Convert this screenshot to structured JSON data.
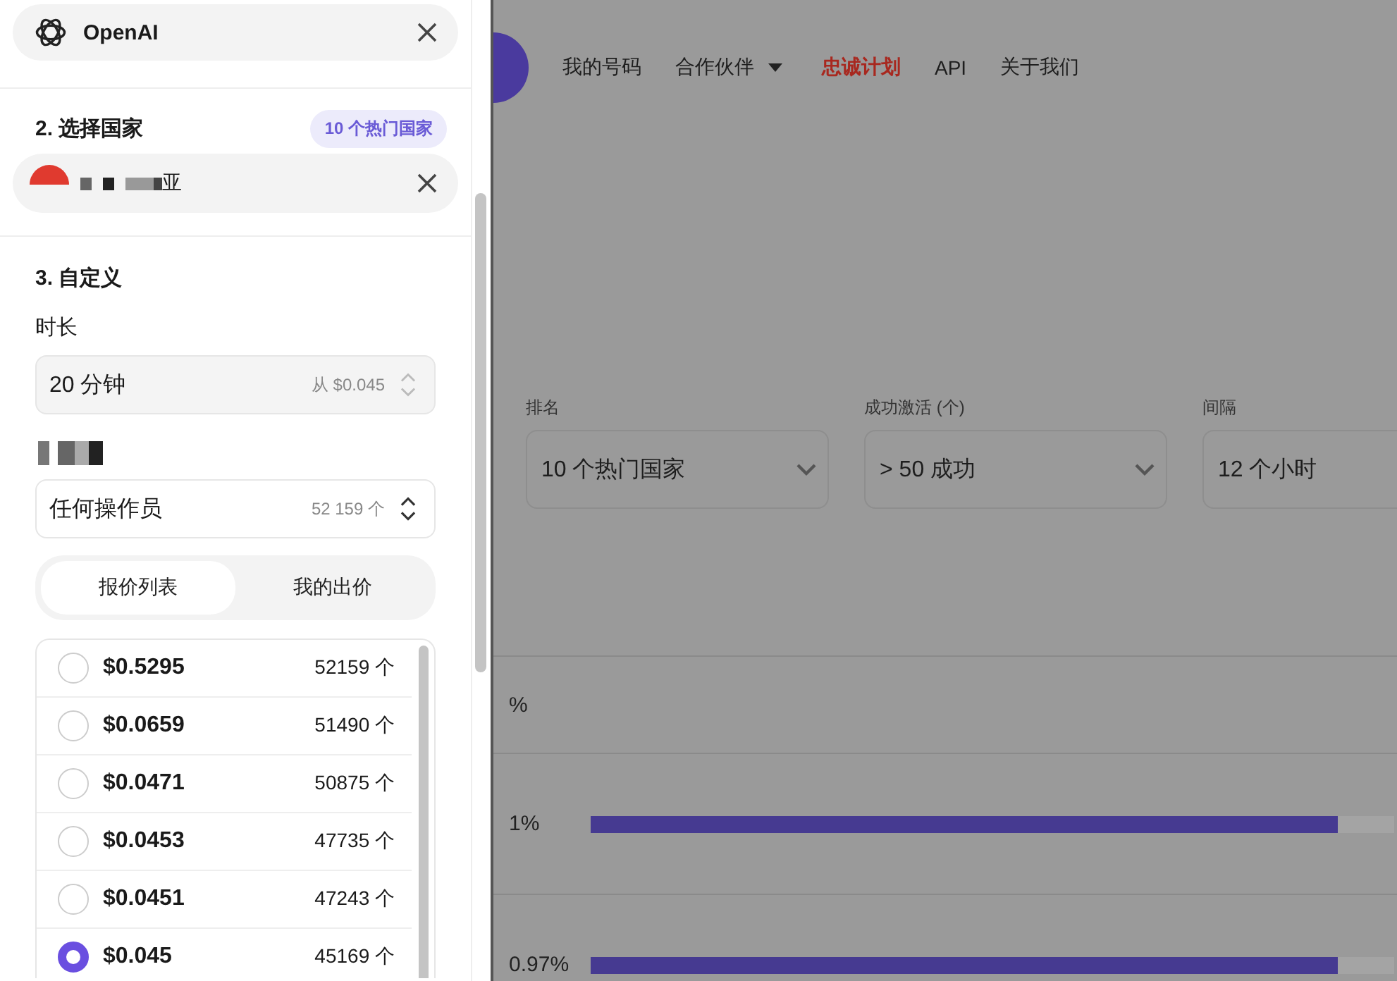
{
  "drawer": {
    "service": {
      "name": "OpenAI"
    },
    "country_section": {
      "title": "2. 选择国家",
      "badge": "10 个热门国家",
      "country": "亚"
    },
    "custom_section": {
      "title": "3. 自定义",
      "duration_label": "时长",
      "duration": {
        "value": "20 分钟",
        "hint": "从 $0.045"
      },
      "operator": {
        "value": "任何操作员",
        "count": "52 159 个"
      },
      "tabs": [
        {
          "label": "报价列表",
          "selected": true
        },
        {
          "label": "我的出价",
          "selected": false
        }
      ],
      "offers": [
        {
          "price": "$0.5295",
          "count": "52159 个",
          "selected": false
        },
        {
          "price": "$0.0659",
          "count": "51490 个",
          "selected": false
        },
        {
          "price": "$0.0471",
          "count": "50875 个",
          "selected": false
        },
        {
          "price": "$0.0453",
          "count": "47735 个",
          "selected": false
        },
        {
          "price": "$0.0451",
          "count": "47243 个",
          "selected": false
        },
        {
          "price": "$0.045",
          "count": "45169 个",
          "selected": true
        }
      ]
    }
  },
  "page": {
    "nav": [
      {
        "label": "我的号码",
        "kind": "link"
      },
      {
        "label": "合作伙伴",
        "kind": "dropdown"
      },
      {
        "label": "忠诚计划",
        "kind": "highlight"
      },
      {
        "label": "API",
        "kind": "link"
      },
      {
        "label": "关于我们",
        "kind": "link"
      }
    ],
    "filters": [
      {
        "label": "排名",
        "value": "10 个热门国家",
        "kind": "select"
      },
      {
        "label": "成功激活 (个)",
        "value": "> 50 成功",
        "kind": "select"
      },
      {
        "label": "间隔",
        "value": "12 个小时",
        "kind": "plain"
      }
    ],
    "table": {
      "header": "%",
      "rows": [
        {
          "rate": "1%",
          "level": 0.93
        },
        {
          "rate": "0.97%",
          "level": 0.93
        }
      ]
    }
  }
}
